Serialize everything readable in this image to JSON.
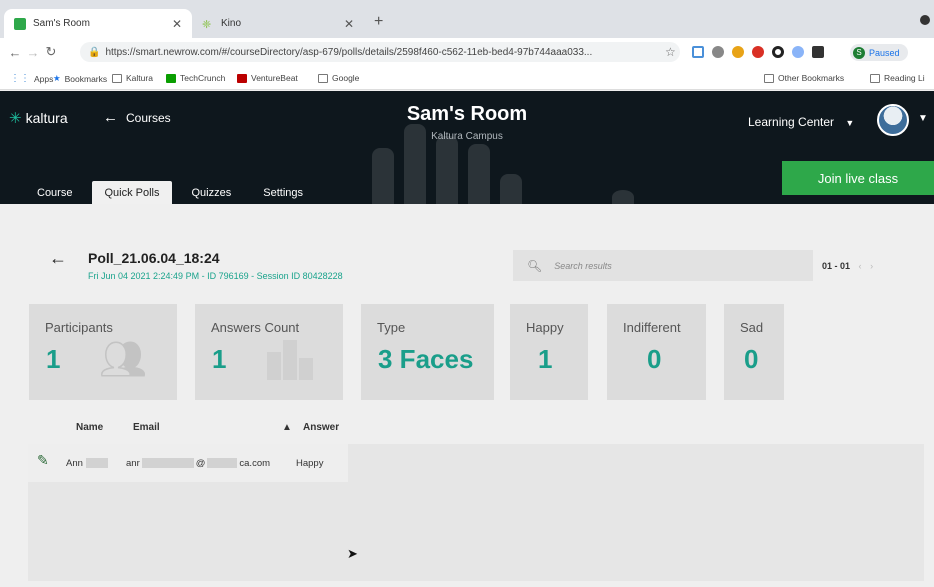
{
  "browser": {
    "tabs": [
      {
        "title": "Sam's Room",
        "favicon_color": "#2ea84a"
      },
      {
        "title": "Kino",
        "favicon_color": "#8bc34a"
      }
    ],
    "url": "https://smart.newrow.com/#/courseDirectory/asp-679/polls/details/2598f460-c562-11eb-bed4-97b744aaa033...",
    "paused_label": "Paused",
    "profile_initial": "S",
    "bookmarks": [
      "Apps",
      "Bookmarks",
      "Kaltura",
      "TechCrunch",
      "VentureBeat",
      "Google"
    ],
    "bookmarks_right": [
      "Other Bookmarks",
      "Reading Li"
    ]
  },
  "header": {
    "logo": "kaltura",
    "back_label": "Courses",
    "title": "Sam's Room",
    "subtitle": "Kaltura Campus",
    "learning_center": "Learning Center",
    "tabs": [
      "Course",
      "Quick Polls",
      "Quizzes",
      "Settings"
    ],
    "join_label": "Join live class"
  },
  "poll": {
    "title": "Poll_21.06.04_18:24",
    "meta": "Fri Jun 04 2021 2:24:49 PM - ID 796169 - Session ID 80428228",
    "search_placeholder": "Search results",
    "pager": "01 - 01",
    "pager_prev": "‹",
    "pager_next": "›"
  },
  "cards": [
    {
      "label": "Participants",
      "value": "1"
    },
    {
      "label": "Answers Count",
      "value": "1"
    },
    {
      "label": "Type",
      "value": "3 Faces"
    },
    {
      "label": "Happy",
      "value": "1"
    },
    {
      "label": "Indifferent",
      "value": "0"
    },
    {
      "label": "Sad",
      "value": "0"
    }
  ],
  "table": {
    "headers": {
      "name": "Name",
      "email": "Email",
      "answer": "Answer"
    },
    "rows": [
      {
        "name": "Ann",
        "email_prefix": "anr",
        "email_mid": "@",
        "email_suffix": "ca.com",
        "answer": "Happy"
      }
    ]
  },
  "colors": {
    "accent": "#1a9e8a",
    "join": "#2ea84a",
    "header_bg": "#0e171d"
  }
}
